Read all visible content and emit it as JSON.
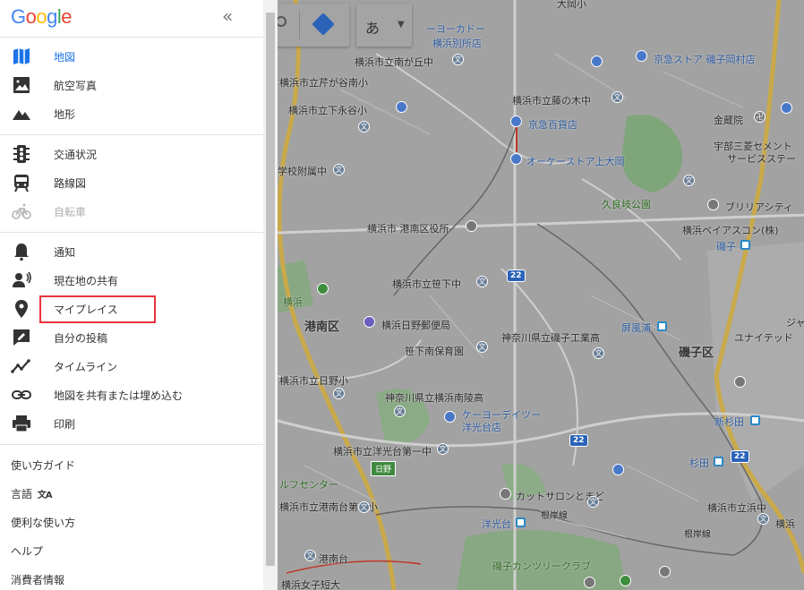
{
  "sidebar": {
    "logo_letters": [
      "G",
      "o",
      "o",
      "g",
      "l",
      "e"
    ],
    "logo_colors": [
      "#4285F4",
      "#EA4335",
      "#FBBC05",
      "#4285F4",
      "#34A853",
      "#EA4335"
    ],
    "collapse_glyph": "«",
    "group1": [
      {
        "label": "地図",
        "icon": "map-icon",
        "state": "active"
      },
      {
        "label": "航空写真",
        "icon": "satellite-icon",
        "state": "normal"
      },
      {
        "label": "地形",
        "icon": "terrain-icon",
        "state": "normal"
      }
    ],
    "group2": [
      {
        "label": "交通状況",
        "icon": "traffic-icon",
        "state": "normal"
      },
      {
        "label": "路線図",
        "icon": "transit-icon",
        "state": "normal"
      },
      {
        "label": "自転車",
        "icon": "bicycle-icon",
        "state": "disabled"
      }
    ],
    "group3": [
      {
        "label": "通知",
        "icon": "bell-icon"
      },
      {
        "label": "現在地の共有",
        "icon": "location-sharing-icon"
      },
      {
        "label": "マイプレイス",
        "icon": "pin-icon"
      },
      {
        "label": "自分の投稿",
        "icon": "contribution-icon"
      },
      {
        "label": "タイムライン",
        "icon": "timeline-icon"
      },
      {
        "label": "地図を共有または埋め込む",
        "icon": "link-icon"
      },
      {
        "label": "印刷",
        "icon": "print-icon"
      }
    ],
    "text_links": [
      "使い方ガイド",
      "言語",
      "便利な使い方",
      "ヘルプ",
      "消費者情報"
    ],
    "language_icon_glyph": "文A"
  },
  "map_controls": {
    "ime_label": "あ"
  },
  "map": {
    "labels": [
      {
        "text": "ーヨーカドー",
        "cls": "blue"
      },
      {
        "text": "横浜別所店",
        "cls": "blue"
      },
      {
        "text": "大岡小",
        "cls": ""
      },
      {
        "text": "横浜市立南が丘中",
        "cls": ""
      },
      {
        "text": "京急ストア 磯子岡村店",
        "cls": "blue"
      },
      {
        "text": "横浜市立芹が谷南小",
        "cls": ""
      },
      {
        "text": "横浜市立藤の木中",
        "cls": ""
      },
      {
        "text": "横浜市立下永谷小",
        "cls": ""
      },
      {
        "text": "京急百貨店",
        "cls": "blue"
      },
      {
        "text": "金蔵院",
        "cls": ""
      },
      {
        "text": "宇部三菱セメント",
        "cls": ""
      },
      {
        "text": "サービスステー",
        "cls": ""
      },
      {
        "text": "オーケーストア上大岡",
        "cls": "blue"
      },
      {
        "text": "学校附属中",
        "cls": ""
      },
      {
        "text": "久良岐公園",
        "cls": "green"
      },
      {
        "text": "ブリリアシティ",
        "cls": ""
      },
      {
        "text": "横浜市 港南区役所",
        "cls": ""
      },
      {
        "text": "横浜ベイアスコン(株)",
        "cls": ""
      },
      {
        "text": "磯子",
        "cls": "blue"
      },
      {
        "text": "横浜市立笹下中",
        "cls": ""
      },
      {
        "text": "横浜",
        "cls": "green"
      },
      {
        "text": "港南区",
        "cls": "bold"
      },
      {
        "text": "横浜日野郵便局",
        "cls": ""
      },
      {
        "text": "屏風浦",
        "cls": "blue"
      },
      {
        "text": "ジャ",
        "cls": ""
      },
      {
        "text": "神奈川県立磯子工業高",
        "cls": ""
      },
      {
        "text": "ユナイテッド",
        "cls": ""
      },
      {
        "text": "笹下南保育園",
        "cls": ""
      },
      {
        "text": "磯子区",
        "cls": "bold"
      },
      {
        "text": "横浜市立日野小",
        "cls": ""
      },
      {
        "text": "神奈川県立横浜南陵高",
        "cls": ""
      },
      {
        "text": "ケーヨーデイツー",
        "cls": "blue"
      },
      {
        "text": "洋光台店",
        "cls": "blue"
      },
      {
        "text": "新杉田",
        "cls": "blue"
      },
      {
        "text": "横浜市立洋光台第一中",
        "cls": ""
      },
      {
        "text": "杉田",
        "cls": "blue"
      },
      {
        "text": "ルフセンター",
        "cls": "green"
      },
      {
        "text": "カットサロンとまど",
        "cls": ""
      },
      {
        "text": "横浜市立港南台第三小",
        "cls": ""
      },
      {
        "text": "根岸線",
        "cls": "road"
      },
      {
        "text": "横浜市立浜中",
        "cls": ""
      },
      {
        "text": "洋光台",
        "cls": "blue"
      },
      {
        "text": "横浜",
        "cls": ""
      },
      {
        "text": "根岸線",
        "cls": "road"
      },
      {
        "text": "港南台",
        "cls": ""
      },
      {
        "text": "磯子カンツリークラブ",
        "cls": "green"
      },
      {
        "text": "横浜女子短大",
        "cls": ""
      }
    ],
    "route_numbers": [
      "22",
      "22",
      "22"
    ],
    "road_tags": [
      "日野"
    ]
  }
}
